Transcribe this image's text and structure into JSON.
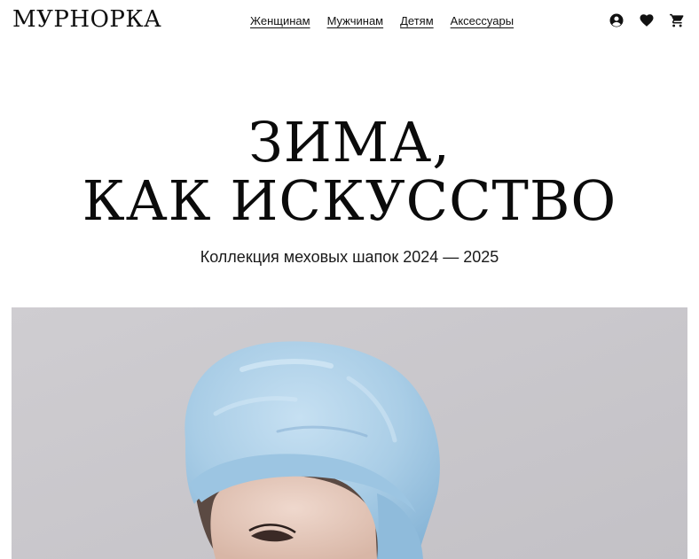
{
  "brand": {
    "logo_text": "МУРНОРКА"
  },
  "nav": {
    "items": [
      {
        "label": "Женщинам"
      },
      {
        "label": "Мужчинам"
      },
      {
        "label": "Детям"
      },
      {
        "label": "Аксессуары"
      }
    ]
  },
  "header_icons": [
    {
      "icon": "account-icon"
    },
    {
      "icon": "heart-icon"
    },
    {
      "icon": "cart-icon"
    }
  ],
  "hero": {
    "title_line1": "ЗИМА,",
    "title_line2": "КАК ИСКУССТВО",
    "subtitle": "Коллекция меховых шапок 2024 — 2025"
  },
  "colors": {
    "background": "#ffffff",
    "text": "#111111",
    "photo_background": "#c9c7cc",
    "hat": "#a9cde6"
  }
}
